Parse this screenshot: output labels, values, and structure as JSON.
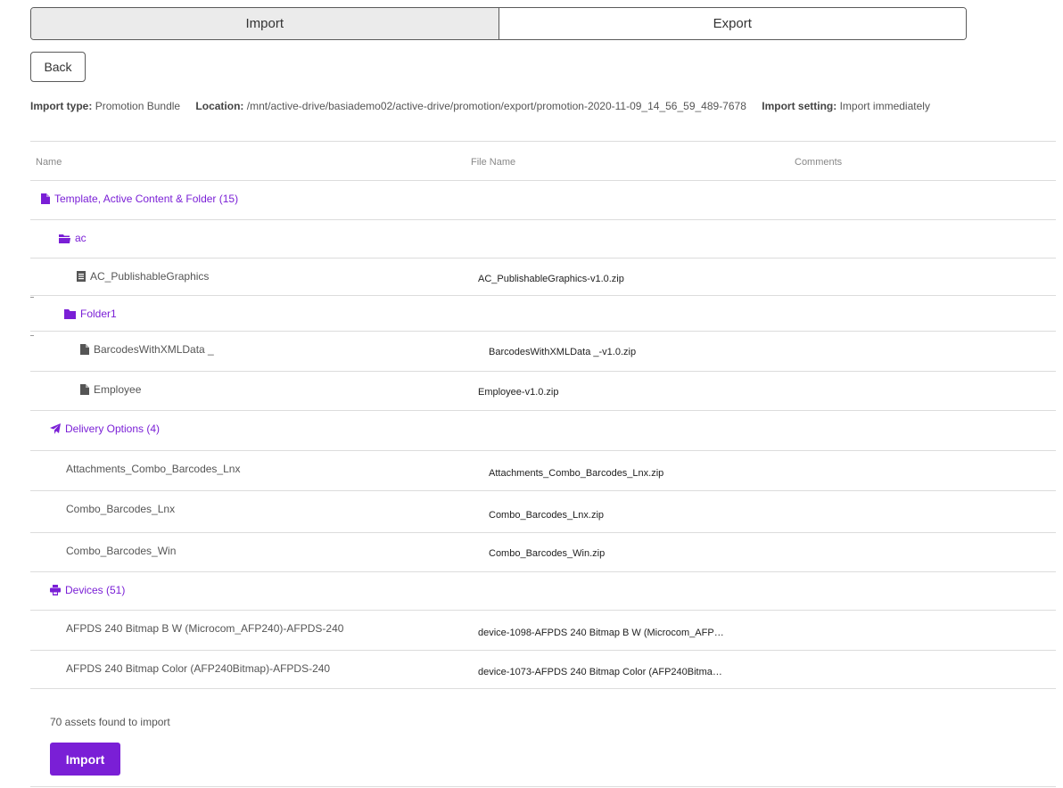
{
  "tabs": [
    {
      "label": "Import",
      "active": true
    },
    {
      "label": "Export",
      "active": false
    }
  ],
  "back_label": "Back",
  "info": {
    "type_label": "Import type:",
    "type_value": "Promotion Bundle",
    "location_label": "Location:",
    "location_value": "/mnt/active-drive/basiademo02/active-drive/promotion/export/promotion-2020-11-09_14_56_59_489-7678",
    "setting_label": "Import setting:",
    "setting_value": "Import immediately"
  },
  "columns": {
    "name": "Name",
    "file_name": "File Name",
    "comments": "Comments"
  },
  "rows": [
    {
      "name": "Template, Active Content & Folder (15)",
      "file": "",
      "icon": "file-icon",
      "group": true
    },
    {
      "name": "ac",
      "file": "",
      "icon": "folder-open-icon",
      "group": true
    },
    {
      "name": "AC_PublishableGraphics",
      "file": "AC_PublishableGraphics-v1.0.zip",
      "icon": "document-icon",
      "group": false
    },
    {
      "name": "Folder1",
      "file": "",
      "icon": "folder-icon",
      "group": true
    },
    {
      "name": "BarcodesWithXMLData _",
      "file": "BarcodesWithXMLData _-v1.0.zip",
      "icon": "file-icon",
      "group": false
    },
    {
      "name": "Employee",
      "file": "Employee-v1.0.zip",
      "icon": "file-icon",
      "group": false
    },
    {
      "name": "Delivery Options (4)",
      "file": "",
      "icon": "paper-plane-icon",
      "group": true
    },
    {
      "name": "Attachments_Combo_Barcodes_Lnx",
      "file": "Attachments_Combo_Barcodes_Lnx.zip",
      "icon": "",
      "group": false
    },
    {
      "name": "Combo_Barcodes_Lnx",
      "file": "Combo_Barcodes_Lnx.zip",
      "icon": "",
      "group": false
    },
    {
      "name": "Combo_Barcodes_Win",
      "file": "Combo_Barcodes_Win.zip",
      "icon": "",
      "group": false
    },
    {
      "name": "Devices (51)",
      "file": "",
      "icon": "printer-icon",
      "group": true
    },
    {
      "name": "AFPDS 240 Bitmap B W (Microcom_AFP240)-AFPDS-240",
      "file": "device-1098-AFPDS 240 Bitmap B W (Microcom_AFP…",
      "icon": "",
      "group": false
    },
    {
      "name": "AFPDS 240 Bitmap Color (AFP240Bitmap)-AFPDS-240",
      "file": "device-1073-AFPDS 240 Bitmap Color (AFP240Bitma…",
      "icon": "",
      "group": false
    }
  ],
  "footer": {
    "count": "70 assets found to import",
    "import_label": "Import"
  },
  "colors": {
    "accent": "#7a1fd6",
    "tab_active_bg": "#ebebeb"
  }
}
